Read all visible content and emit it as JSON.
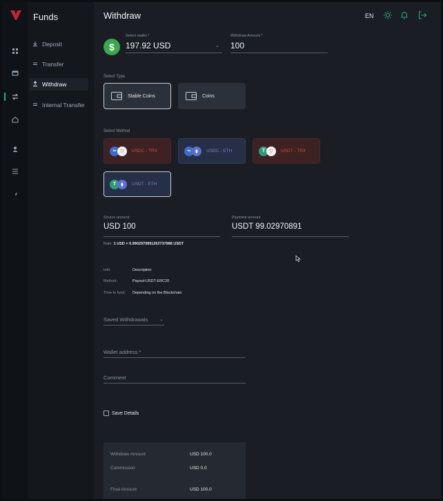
{
  "rail": {
    "icons": [
      "dashboard-icon",
      "wallet-icon",
      "transfer-icon",
      "home-icon",
      "user-icon",
      "list-icon",
      "rocket-icon"
    ]
  },
  "subnav": {
    "title": "Funds",
    "items": [
      {
        "label": "Deposit",
        "icon": "deposit-icon"
      },
      {
        "label": "Transfer",
        "icon": "transfer-lines-icon"
      },
      {
        "label": "Withdraw",
        "icon": "withdraw-icon"
      },
      {
        "label": "Internal Transfer",
        "icon": "internal-transfer-icon"
      }
    ]
  },
  "header": {
    "title": "Withdraw",
    "lang": "EN"
  },
  "wallet": {
    "label": "Select wallet *",
    "value": "197.92 USD",
    "badge": "$"
  },
  "withdraw_amount": {
    "label": "Withdraw Amount *",
    "value": "100"
  },
  "type": {
    "label": "Select Type",
    "options": [
      "Stable Coins",
      "Coins"
    ]
  },
  "method": {
    "label": "Select Method",
    "options": [
      "USDC - TRX",
      "USDC - ETH",
      "USDT - TRX",
      "USDT - ETH"
    ]
  },
  "source_amount": {
    "label": "Source amount",
    "value": "USD 100"
  },
  "payment_amount": {
    "label": "Payment amount",
    "value": "USDT 99.02970891"
  },
  "rate": {
    "prefix": "Rate:",
    "value": "1 USD = 0.9902970891262737988 USDT"
  },
  "info": {
    "info_key": "Info:",
    "info_val": "Description",
    "method_key": "Method:",
    "method_val": "Payout-USDT-ERC20",
    "time_key": "Time to fund:",
    "time_val": "Depending on the Blockchain"
  },
  "saved": {
    "label": "Saved Withdrawals"
  },
  "address": {
    "label": "Wallet address *"
  },
  "comment": {
    "label": "Comment"
  },
  "save_details": {
    "label": "Save Details"
  },
  "summary": {
    "withdraw_key": "Withdraw Amount",
    "withdraw_val": "USD  100.0",
    "commission_key": "Commission",
    "commission_val": "USD  0.0",
    "final_key": "Final Amount",
    "final_val": "USD  100.0"
  },
  "colors": {
    "accent": "#1fb77a",
    "usd_badge": "#3aa84f",
    "trx_card": "#3d2123",
    "eth_card": "#262f45"
  }
}
